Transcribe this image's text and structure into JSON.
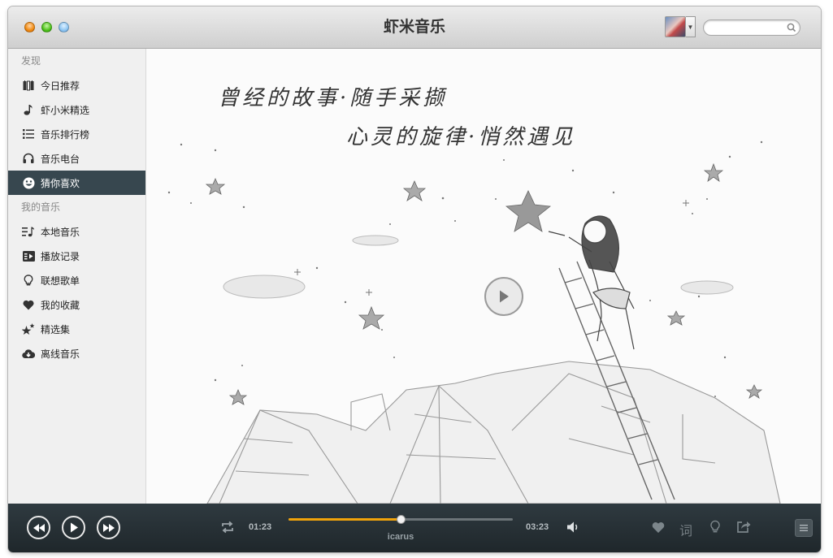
{
  "window": {
    "title": "虾米音乐"
  },
  "search": {
    "placeholder": "",
    "value": ""
  },
  "sidebar": {
    "sections": [
      {
        "title": "发现",
        "items": [
          {
            "label": "今日推荐",
            "icon": "calendar-grid-icon"
          },
          {
            "label": "虾小米精选",
            "icon": "music-note-icon"
          },
          {
            "label": "音乐排行榜",
            "icon": "list-icon"
          },
          {
            "label": "音乐电台",
            "icon": "headphones-icon"
          },
          {
            "label": "猜你喜欢",
            "icon": "smiley-icon",
            "active": true
          }
        ]
      },
      {
        "title": "我的音乐",
        "items": [
          {
            "label": "本地音乐",
            "icon": "local-music-icon"
          },
          {
            "label": "播放记录",
            "icon": "history-icon"
          },
          {
            "label": "联想歌单",
            "icon": "lightbulb-icon"
          },
          {
            "label": "我的收藏",
            "icon": "heart-icon"
          },
          {
            "label": "精选集",
            "icon": "stars-icon"
          },
          {
            "label": "离线音乐",
            "icon": "cloud-download-icon"
          }
        ]
      }
    ]
  },
  "main": {
    "slogan_line1": "曾经的故事·随手采撷",
    "slogan_line2": "心灵的旋律·悄然遇见"
  },
  "player": {
    "current_time": "01:23",
    "total_time": "03:23",
    "song_title": "icarus",
    "progress": 0.5,
    "lyrics_label": "词"
  },
  "colors": {
    "accent": "#f0a30a",
    "sidebar_active": "#37474f",
    "player_bg": "#263035"
  }
}
